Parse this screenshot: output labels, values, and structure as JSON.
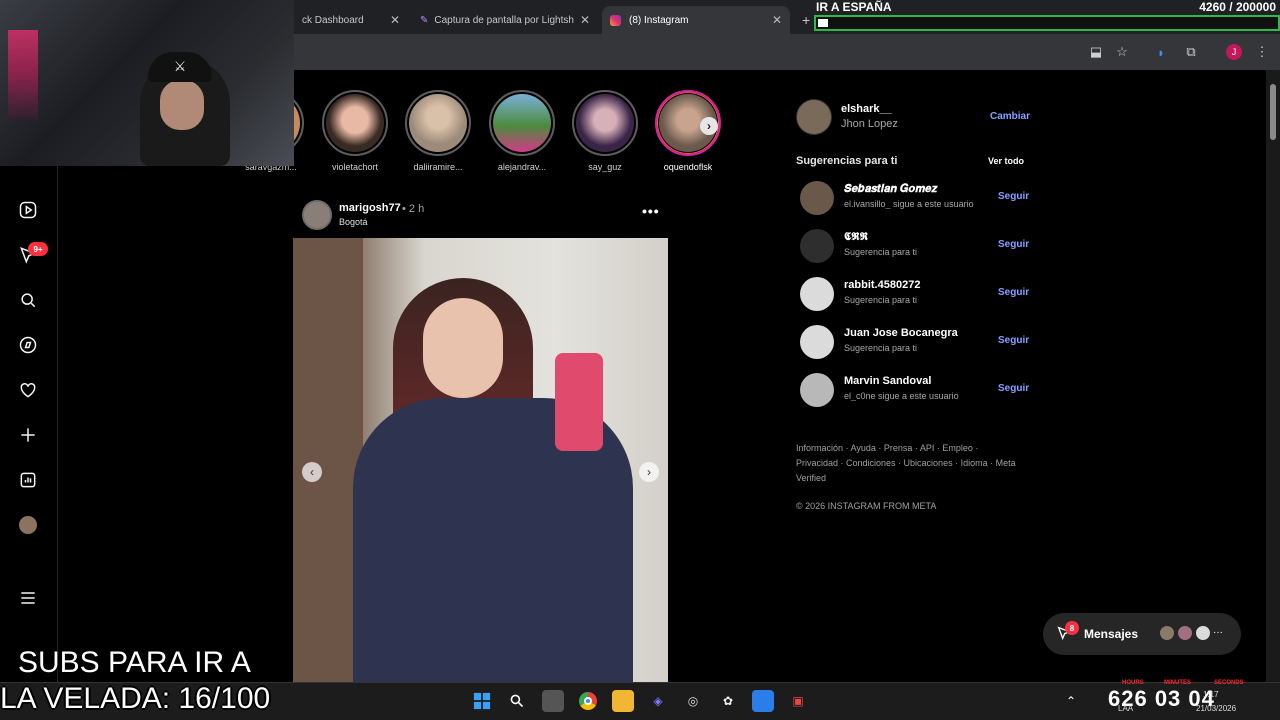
{
  "browser": {
    "tabs": [
      {
        "label": "ck Dashboard",
        "active": false
      },
      {
        "label": "Captura de pantalla por Lightsh",
        "active": false
      },
      {
        "label": "(8) Instagram",
        "active": true
      }
    ],
    "new_tab": "+",
    "close": "✕",
    "profile_initial": "J"
  },
  "goal": {
    "title": "IR A ESPAÑA",
    "count": "4260 / 200000",
    "progress": 0.0213
  },
  "stories": [
    {
      "name": "saravgazm..."
    },
    {
      "name": "violetachort"
    },
    {
      "name": "daliiramire..."
    },
    {
      "name": "alejandrav..."
    },
    {
      "name": "say_guz"
    },
    {
      "name": "oquendoflsk"
    }
  ],
  "sidebar": {
    "notif_badge": "9+"
  },
  "post": {
    "user": "marigosh77",
    "time": "• 2 h",
    "location": "Bogotá",
    "more": "•••"
  },
  "me": {
    "username": "elshark__",
    "name": "Jhon Lopez",
    "switch": "Cambiar"
  },
  "suggestions": {
    "title": "Sugerencias para ti",
    "see_all": "Ver todo",
    "items": [
      {
        "username": "𝑺𝒆𝒃𝒂𝒔𝒕𝒊𝒂𝒏 𝑮𝒐𝒎𝒆𝒛",
        "sub": "el.ivansillo_ sigue a este usuario",
        "action": "Seguir"
      },
      {
        "username": "𝕮𝕽𝕽",
        "sub": "Sugerencia para ti",
        "action": "Seguir"
      },
      {
        "username": "rabbit.4580272",
        "sub": "Sugerencia para ti",
        "action": "Seguir"
      },
      {
        "username": "Juan Jose Bocanegra",
        "sub": "Sugerencia para ti",
        "action": "Seguir"
      },
      {
        "username": "Marvin Sandoval",
        "sub": "el_c0ne sigue a este usuario",
        "action": "Seguir"
      }
    ]
  },
  "footer": {
    "links": "Información · Ayuda · Prensa · API · Empleo · Privacidad · Condiciones · Ubicaciones · Idioma · Meta Verified",
    "copyright": "© 2026 INSTAGRAM FROM META"
  },
  "messages": {
    "label": "Mensajes",
    "badge": "8",
    "more": "···"
  },
  "overlay": {
    "line1": "SUBS PARA IR A",
    "line2": "LA VELADA: 16/100"
  },
  "counter": {
    "value": "626 03 04",
    "labels": [
      "HOURS",
      "MINUTES",
      "SECONDS"
    ]
  },
  "clock": {
    "time": "1:17",
    "date": "21/03/2026",
    "lang": "LAA"
  }
}
